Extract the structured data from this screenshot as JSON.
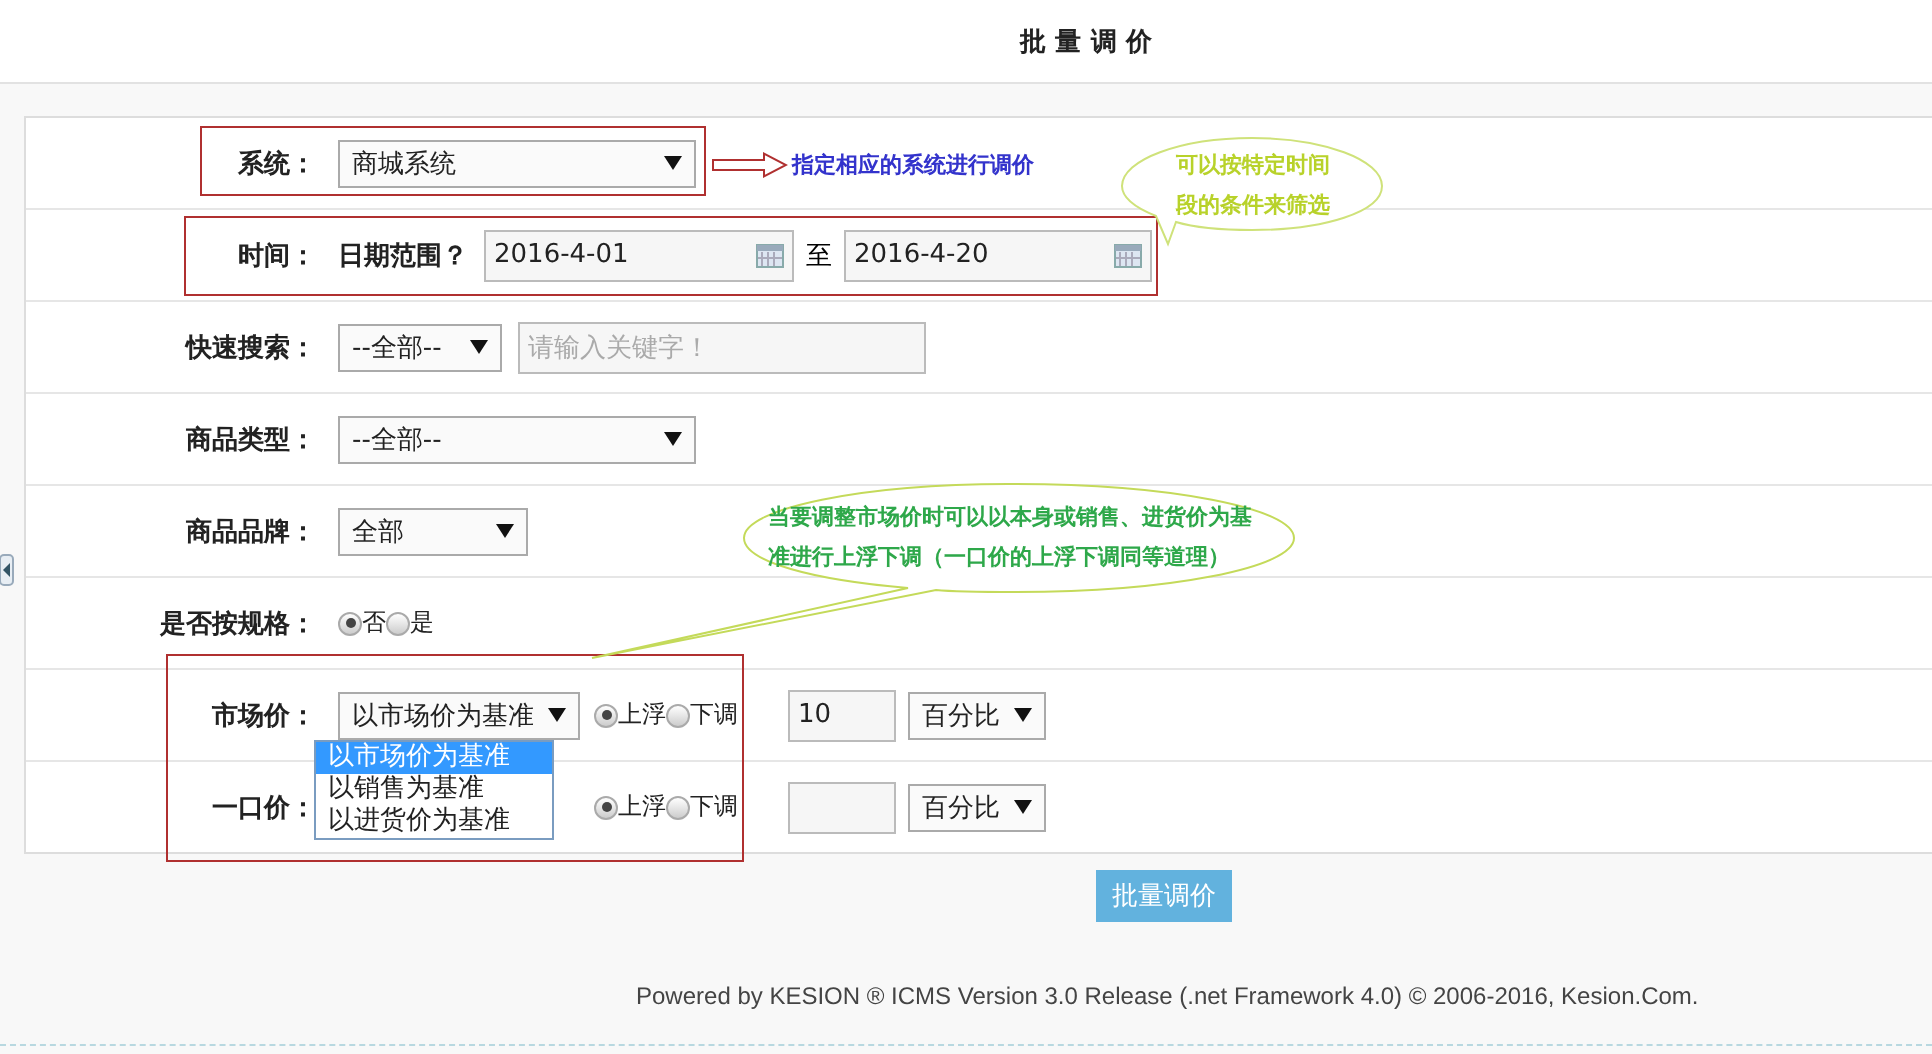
{
  "title": "批 量 调 价",
  "form": {
    "rows": [
      {
        "kind": "select",
        "label": "系统：",
        "value": "商城系统"
      },
      {
        "kind": "daterange",
        "label": "时间：",
        "sublabel": "日期范围？",
        "from": "2016-4-01",
        "separator": "至",
        "to": "2016-4-20"
      },
      {
        "kind": "search",
        "label": "快速搜索：",
        "value": "--全部--",
        "placeholder": "请输入关键字！"
      },
      {
        "kind": "select",
        "label": "商品类型：",
        "value": "--全部--"
      },
      {
        "kind": "select_short",
        "label": "商品品牌：",
        "value": "全部"
      },
      {
        "kind": "radio",
        "label": "是否按规格：",
        "options": [
          {
            "label": "否",
            "selected": true
          },
          {
            "label": "是",
            "selected": false
          }
        ]
      },
      {
        "kind": "price",
        "label": "市场价：",
        "value": "以市场价为基准",
        "dropdown": [
          {
            "label": "以市场价为基准",
            "selected": true
          },
          {
            "label": "以销售为基准",
            "selected": false
          },
          {
            "label": "以进货价为基准",
            "selected": false
          }
        ],
        "options": [
          {
            "label": "上浮",
            "selected": true
          },
          {
            "label": "下调",
            "selected": false
          }
        ],
        "amount": "10",
        "unit": "百分比"
      },
      {
        "kind": "price",
        "label": "一口价：",
        "options": [
          {
            "label": "上浮",
            "selected": true
          },
          {
            "label": "下调",
            "selected": false
          }
        ],
        "unit": "百分比"
      }
    ]
  },
  "submit": "批量调价",
  "footer": "Powered by KESION ® ICMS Version 3.0 Release (.net Framework 4.0) © 2006-2016, Kesion.Com.",
  "annotations": [
    {
      "kind": "arrow_note",
      "text": "指定相应的系统进行调价"
    },
    {
      "kind": "bubble",
      "text": "可以按特定时间段的条件来筛选"
    },
    {
      "kind": "bubble",
      "text": "当要调整市场价时可以以本身或销售、进货价为基准进行上浮下调（一口价的上浮下调同等道理）"
    }
  ]
}
